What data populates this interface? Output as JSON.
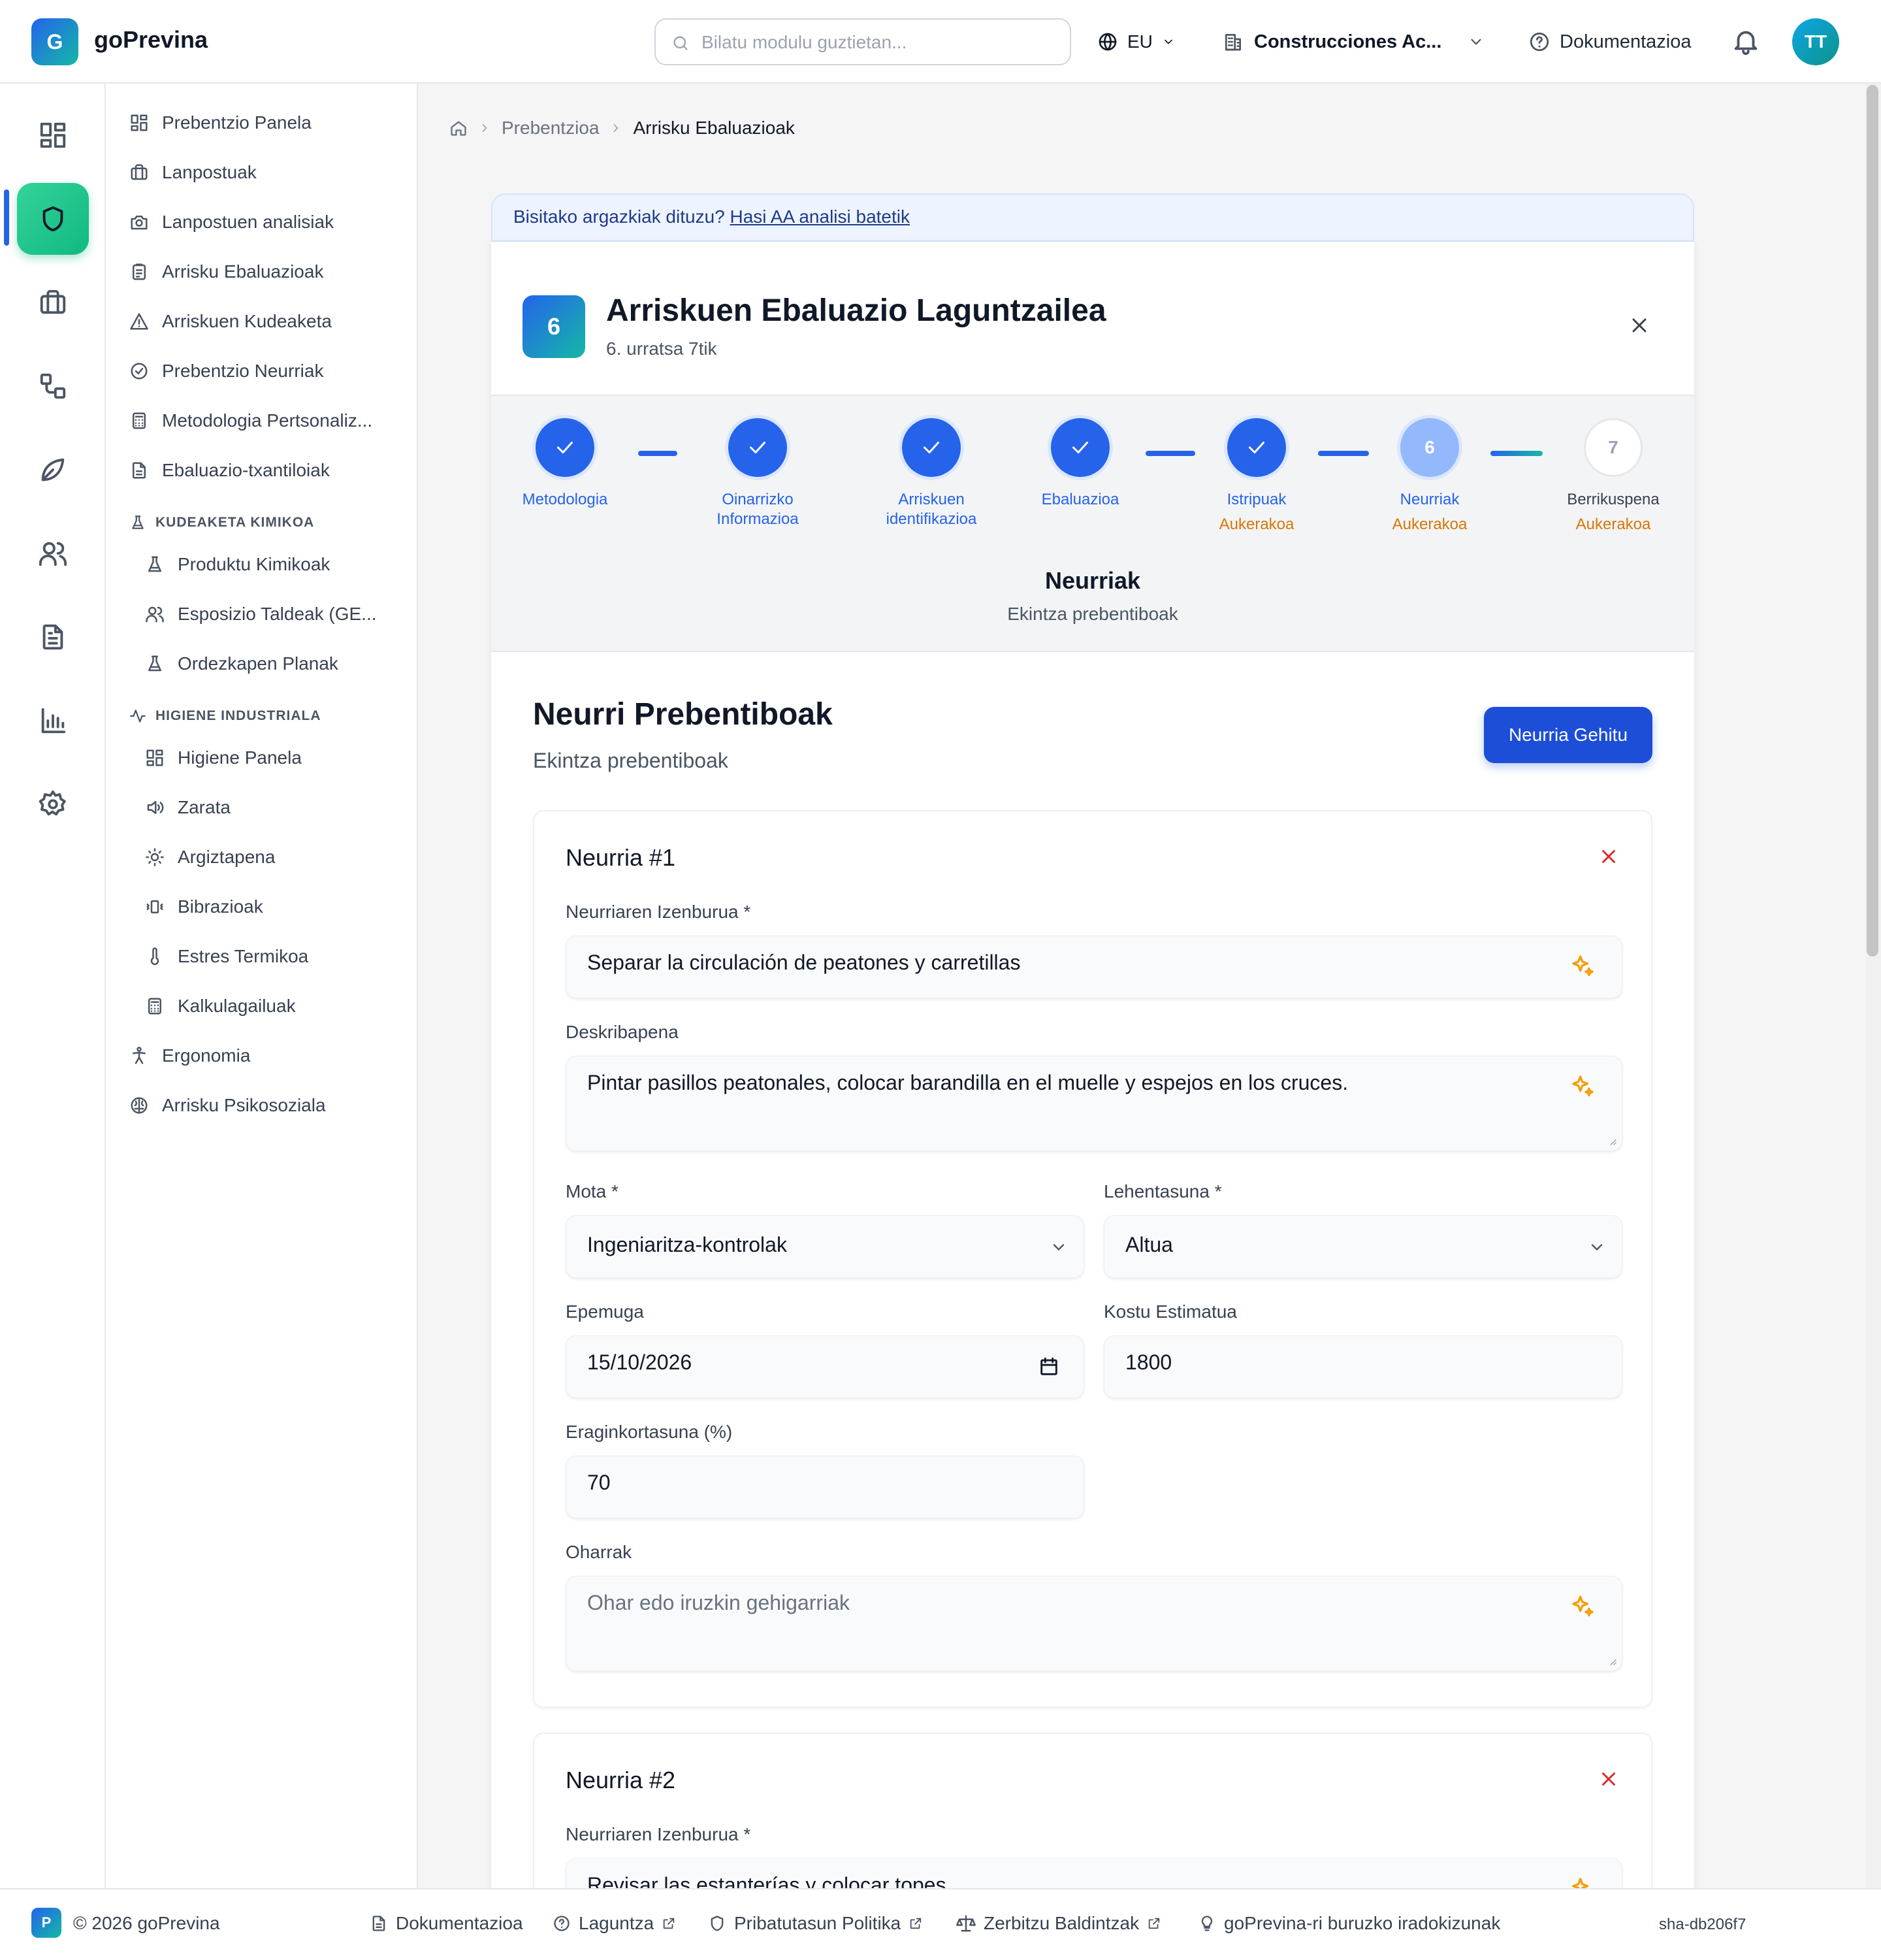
{
  "app": {
    "logo_letter": "G",
    "name": "goPrevina"
  },
  "topbar": {
    "search_placeholder": "Bilatu modulu guztietan...",
    "language": "EU",
    "company": "Construcciones Ac...",
    "docs": "Dokumentazioa",
    "avatar_initials": "TT"
  },
  "rail": [
    "grid-icon",
    "shield-icon",
    "briefcase-icon",
    "workflow-icon",
    "leaf-icon",
    "users-icon",
    "file-icon",
    "chart-icon",
    "settings-icon"
  ],
  "sidebar": {
    "items": [
      {
        "label": "Prebentzio Panela",
        "icon": "grid-icon"
      },
      {
        "label": "Lanpostuak",
        "icon": "briefcase-icon"
      },
      {
        "label": "Lanpostuen analisiak",
        "icon": "camera-icon"
      },
      {
        "label": "Arrisku Ebaluazioak",
        "icon": "clipboard-icon"
      },
      {
        "label": "Arriskuen Kudeaketa",
        "icon": "warning-icon"
      },
      {
        "label": "Prebentzio Neurriak",
        "icon": "check-circle-icon"
      },
      {
        "label": "Metodologia Pertsonaliz...",
        "icon": "calculator-icon"
      },
      {
        "label": "Ebaluazio-txantiloiak",
        "icon": "file-icon"
      }
    ],
    "chem_section": "KUDEAKETA KIMIKOA",
    "chem_items": [
      {
        "label": "Produktu Kimikoak",
        "icon": "flask-icon"
      },
      {
        "label": "Esposizio Taldeak (GE...",
        "icon": "users-icon"
      },
      {
        "label": "Ordezkapen Planak",
        "icon": "flask-icon"
      }
    ],
    "hyg_section": "HIGIENE INDUSTRIALA",
    "hyg_items": [
      {
        "label": "Higiene Panela",
        "icon": "grid-icon"
      },
      {
        "label": "Zarata",
        "icon": "volume-icon"
      },
      {
        "label": "Argiztapena",
        "icon": "sun-icon"
      },
      {
        "label": "Bibrazioak",
        "icon": "vibrate-icon"
      },
      {
        "label": "Estres Termikoa",
        "icon": "thermometer-icon"
      },
      {
        "label": "Kalkulagailuak",
        "icon": "calculator-icon"
      }
    ],
    "bottom_items": [
      {
        "label": "Ergonomia",
        "icon": "person-icon"
      },
      {
        "label": "Arrisku Psikosoziala",
        "icon": "brain-icon"
      }
    ]
  },
  "breadcrumb": {
    "parent": "Prebentzioa",
    "current": "Arrisku Ebaluazioak"
  },
  "banner": {
    "text": "Bisitako argazkiak dituzu? ",
    "link": "Hasi AA analisi batetik"
  },
  "wizard": {
    "step_number": "6",
    "title": "Arriskuen Ebaluazio Laguntzailea",
    "subtitle": "6. urratsa 7tik",
    "steps": [
      {
        "label": "Metodologia",
        "status": "done"
      },
      {
        "label": "Oinarrizko Informazioa",
        "status": "done"
      },
      {
        "label": "Arriskuen identifikazioa",
        "status": "done"
      },
      {
        "label": "Ebaluazioa",
        "status": "done"
      },
      {
        "label": "Istripuak",
        "optional": "Aukerakoa",
        "status": "done"
      },
      {
        "label": "Neurriak",
        "optional": "Aukerakoa",
        "status": "current",
        "number": "6"
      },
      {
        "label": "Berrikuspena",
        "optional": "Aukerakoa",
        "status": "todo",
        "number": "7"
      }
    ],
    "current_name": "Neurriak",
    "current_desc": "Ekintza prebentiboak"
  },
  "section": {
    "title": "Neurri Prebentiboak",
    "subtitle": "Ekintza prebentiboak",
    "add_button": "Neurria Gehitu"
  },
  "labels": {
    "title": "Neurriaren Izenburua *",
    "description": "Deskribapena",
    "type": "Mota *",
    "priority": "Lehentasuna *",
    "deadline": "Epemuga",
    "cost": "Kostu Estimatua",
    "effectiveness": "Eraginkortasuna (%)",
    "notes": "Oharrak",
    "notes_placeholder": "Ohar edo iruzkin gehigarriak"
  },
  "measures": [
    {
      "heading": "Neurria #1",
      "title": "Separar la circulación de peatones y carretillas",
      "description": "Pintar pasillos peatonales, colocar barandilla en el muelle y espejos en los cruces.",
      "type": "Ingeniaritza-kontrolak",
      "priority": "Altua",
      "deadline": "15/10/2026",
      "cost": "1800",
      "effectiveness": "70",
      "notes": ""
    },
    {
      "heading": "Neurria #2",
      "title": "Revisar las estanterías y colocar topes"
    }
  ],
  "footer": {
    "logo_letter": "P",
    "copyright": "© 2026 goPrevina",
    "links": [
      "Dokumentazioa",
      "Laguntza",
      "Pribatutasun Politika",
      "Zerbitzu Baldintzak",
      "goPrevina-ri buruzko iradokizunak"
    ],
    "sha": "sha-db206f7"
  },
  "colors": {
    "primary": "#1d4ed8",
    "accent": "#10b981",
    "optional": "#d97706",
    "danger": "#dc2626"
  }
}
